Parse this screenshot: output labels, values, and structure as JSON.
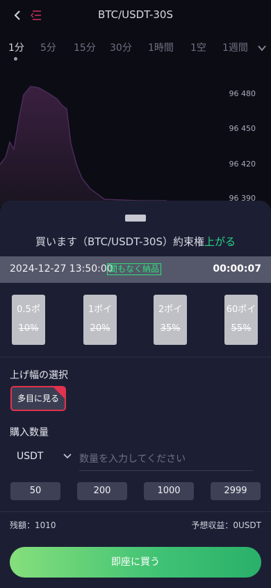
{
  "header": {
    "title": "BTC/USDT-30S"
  },
  "tabs": [
    "1分",
    "5分",
    "15分",
    "30分",
    "1時間",
    "1空",
    "1週間"
  ],
  "chart": {
    "prices": [
      "96 480",
      "96 450",
      "96 420",
      "96 390"
    ]
  },
  "order": {
    "title_main": "買います（BTC/USDT-30S）約束権",
    "title_dir": "上がる",
    "datetime": "2024-12-27 13:50:00",
    "status": "間もなく納品",
    "countdown": "00:00:07",
    "options": [
      {
        "period": "0.5ポ",
        "rate": "10%"
      },
      {
        "period": "1ポイ",
        "rate": "20%"
      },
      {
        "period": "2ポイ",
        "rate": "35%"
      },
      {
        "period": "60ポイ",
        "rate": "55%"
      }
    ],
    "range_label": "上げ幅の選択",
    "range_btn": "多目に見る",
    "qty_label": "購入数量",
    "currency": "USDT",
    "qty_placeholder": "数量を入力してください",
    "quick": [
      "50",
      "200",
      "1000",
      "2999"
    ],
    "balance": "残額：1010",
    "profit": "予想収益：0USDT",
    "buy_label": "即座に買う"
  },
  "colors": {
    "accent_up": "#28d48a",
    "buy_gradient_start": "#86df7c",
    "buy_gradient_end": "#2ab06a",
    "sheet_bg": "#1c1f33"
  }
}
